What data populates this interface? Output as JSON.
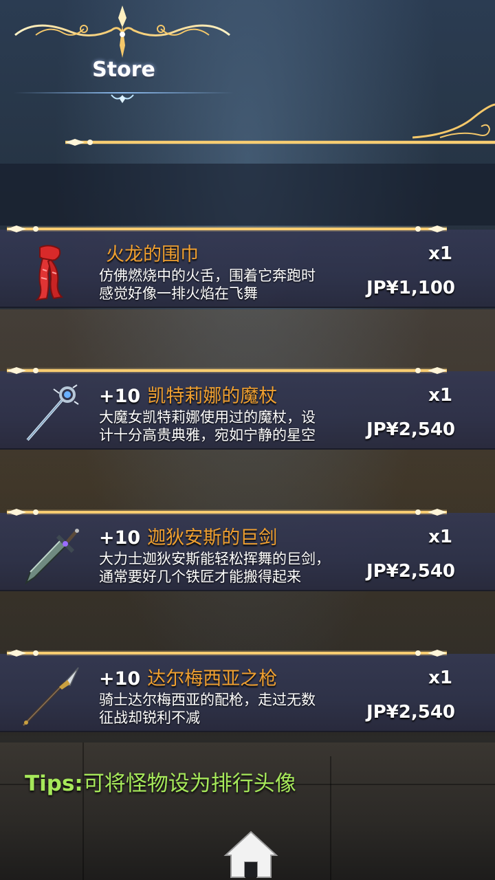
{
  "header": {
    "title": "Store"
  },
  "items": [
    {
      "plus": "",
      "name": "火龙的围巾",
      "desc_line1": "仿佛燃烧中的火舌，围着它奔跑时",
      "desc_line2": "感觉好像一排火焰在飞舞",
      "qty": "x1",
      "price": "JP¥1,100",
      "icon": "red-scarf-icon"
    },
    {
      "plus": "+10",
      "name": "凯特莉娜的魔杖",
      "desc_line1": "大魔女凯特莉娜使用过的魔杖，设",
      "desc_line2": "计十分高贵典雅，宛如宁静的星空",
      "qty": "x1",
      "price": "JP¥2,540",
      "icon": "magic-staff-icon"
    },
    {
      "plus": "+10",
      "name": "迦狄安斯的巨剑",
      "desc_line1": "大力士迦狄安斯能轻松挥舞的巨剑，",
      "desc_line2": "通常要好几个铁匠才能搬得起来",
      "qty": "x1",
      "price": "JP¥2,540",
      "icon": "greatsword-icon"
    },
    {
      "plus": "+10",
      "name": "达尔梅西亚之枪",
      "desc_line1": "骑士达尔梅西亚的配枪，走过无数",
      "desc_line2": "征战却锐利不减",
      "qty": "x1",
      "price": "JP¥2,540",
      "icon": "spear-icon"
    }
  ],
  "tips": {
    "label": "Tips:",
    "text": "可将怪物设为排行头像"
  },
  "colors": {
    "accent_gold": "#f5c86a",
    "item_name": "#f0a030",
    "tips": "#a6e85a",
    "panel": "#343852"
  }
}
